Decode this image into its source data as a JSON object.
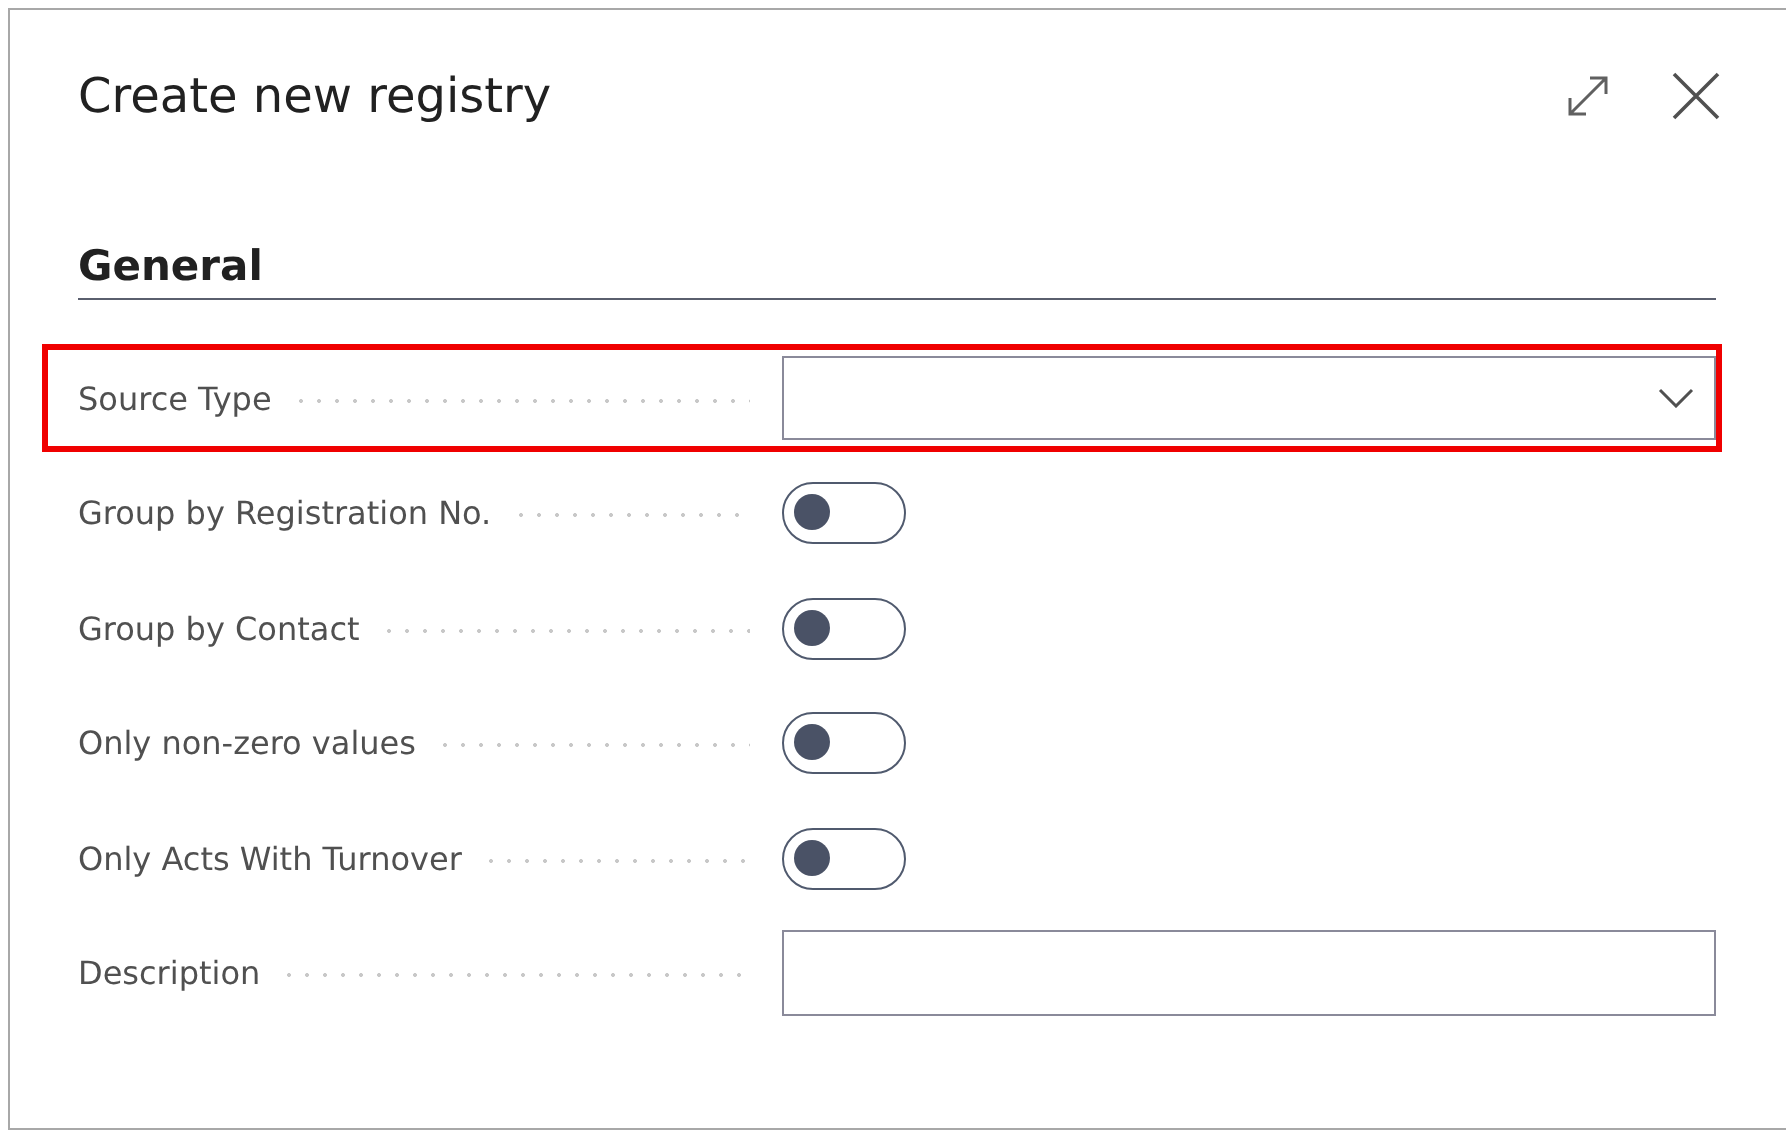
{
  "dialog": {
    "title": "Create new registry"
  },
  "section": {
    "title": "General"
  },
  "fields": [
    {
      "label": "Source Type",
      "kind": "dropdown",
      "highlighted": true
    },
    {
      "label": "Group by Registration No.",
      "kind": "toggle",
      "on": false,
      "highlighted": false
    },
    {
      "label": "Group by Contact",
      "kind": "toggle",
      "on": false,
      "highlighted": false
    },
    {
      "label": "Only non-zero values",
      "kind": "toggle",
      "on": false,
      "highlighted": false
    },
    {
      "label": "Only Acts With Turnover",
      "kind": "toggle",
      "on": false,
      "highlighted": false
    },
    {
      "label": "Description",
      "kind": "text",
      "highlighted": false
    }
  ]
}
